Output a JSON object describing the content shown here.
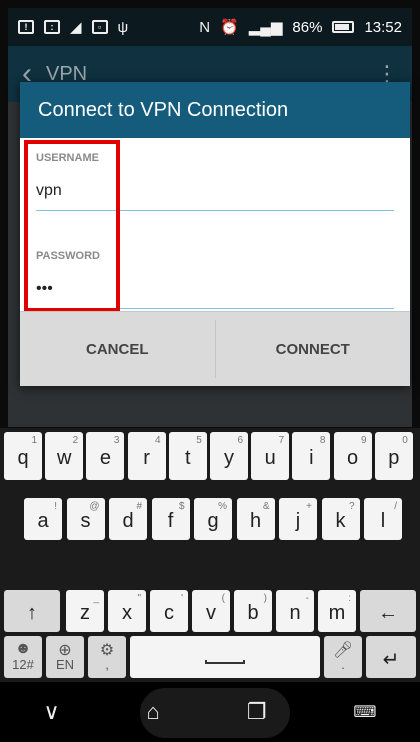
{
  "status_bar": {
    "battery_percent": "86%",
    "time": "13:52"
  },
  "app_bar": {
    "title": "VPN"
  },
  "dialog": {
    "title": "Connect to VPN Connection",
    "username_label": "USERNAME",
    "username_value": "vpn",
    "password_label": "PASSWORD",
    "password_value": "•••",
    "cancel_label": "CANCEL",
    "connect_label": "CONNECT",
    "highlight_color": "#e00000",
    "accent_color": "#145b7c"
  },
  "keyboard": {
    "row1": [
      {
        "main": "q",
        "sec": "1"
      },
      {
        "main": "w",
        "sec": "2"
      },
      {
        "main": "e",
        "sec": "3"
      },
      {
        "main": "r",
        "sec": "4"
      },
      {
        "main": "t",
        "sec": "5"
      },
      {
        "main": "y",
        "sec": "6"
      },
      {
        "main": "u",
        "sec": "7"
      },
      {
        "main": "i",
        "sec": "8"
      },
      {
        "main": "o",
        "sec": "9"
      },
      {
        "main": "p",
        "sec": "0"
      }
    ],
    "row2": [
      {
        "main": "a",
        "sec": "!"
      },
      {
        "main": "s",
        "sec": "@"
      },
      {
        "main": "d",
        "sec": "#"
      },
      {
        "main": "f",
        "sec": "$"
      },
      {
        "main": "g",
        "sec": "%"
      },
      {
        "main": "h",
        "sec": "&"
      },
      {
        "main": "j",
        "sec": "+"
      },
      {
        "main": "k",
        "sec": "?"
      },
      {
        "main": "l",
        "sec": "/"
      }
    ],
    "row3": [
      {
        "main": "z",
        "sec": "_"
      },
      {
        "main": "x",
        "sec": "\""
      },
      {
        "main": "c",
        "sec": "'"
      },
      {
        "main": "v",
        "sec": "("
      },
      {
        "main": "b",
        "sec": ")"
      },
      {
        "main": "n",
        "sec": "-"
      },
      {
        "main": "m",
        "sec": ":"
      }
    ],
    "shift_icon": "↑",
    "backspace_icon": "←",
    "symbols_label": "12#",
    "language_label": "EN",
    "comma_label": ",",
    "period_label": ".",
    "enter_icon": "↵"
  },
  "nav_bar": {
    "back_icon": "chevron-down",
    "home_icon": "home",
    "recents_icon": "recents",
    "keyboard_icon": "keyboard"
  }
}
